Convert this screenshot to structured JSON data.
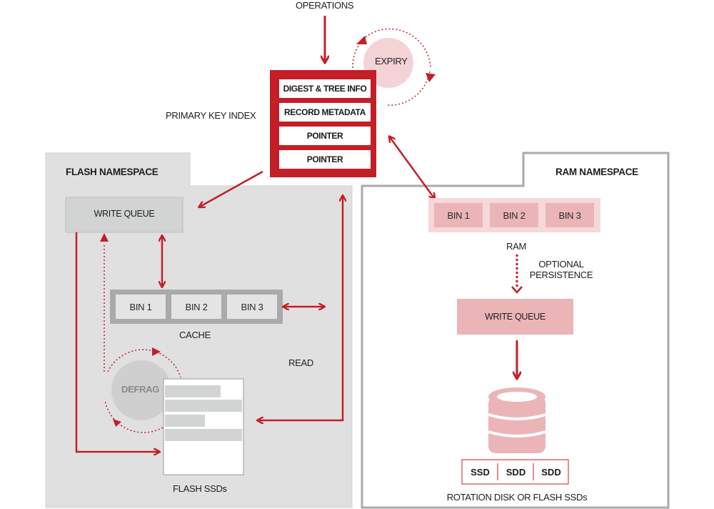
{
  "colors": {
    "accent_red": "#c41e27",
    "flash_bg": "#e0e0e0",
    "ram_pink": "#ebb5b8",
    "ram_pink_light": "#f6d8da",
    "gray_box": "#d2d3d3",
    "gray_border": "#a9aaac"
  },
  "top": {
    "operations_label": "OPERATIONS",
    "expiry_label": "EXPIRY",
    "primary_key_index_label": "PRIMARY KEY INDEX",
    "index_rows": [
      "DIGEST & TREE INFO",
      "RECORD METADATA",
      "POINTER",
      "POINTER"
    ]
  },
  "flash_namespace": {
    "title": "FLASH NAMESPACE",
    "write_queue_label": "WRITE QUEUE",
    "cache_bins": [
      "BIN 1",
      "BIN 2",
      "BIN 3"
    ],
    "cache_label": "CACHE",
    "read_label": "READ",
    "defrag_label": "DEFRAG",
    "flash_ssds_label": "FLASH SSDs"
  },
  "ram_namespace": {
    "title": "RAM NAMESPACE",
    "ram_bins": [
      "BIN 1",
      "BIN 2",
      "BIN 3"
    ],
    "ram_label": "RAM",
    "optional_persistence_label_line1": "OPTIONAL",
    "optional_persistence_label_line2": "PERSISTENCE",
    "write_queue_label": "WRITE QUEUE",
    "storage_cells": [
      "SSD",
      "SDD",
      "SDD"
    ],
    "storage_label": "ROTATION DISK OR FLASH SSDs"
  }
}
